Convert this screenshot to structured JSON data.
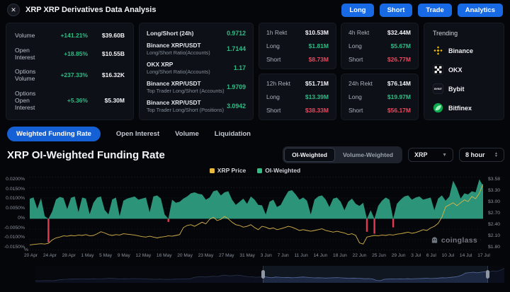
{
  "header": {
    "title": "XRP XRP Derivatives Data Analysis",
    "close_glyph": "✕",
    "buttons": [
      {
        "label": "Long"
      },
      {
        "label": "Short"
      },
      {
        "label": "Trade"
      },
      {
        "label": "Analytics"
      }
    ]
  },
  "stats": {
    "rows": [
      {
        "label": "Volume",
        "change": "+141.21%",
        "value": "$39.60B"
      },
      {
        "label": "Open Interest",
        "change": "+18.85%",
        "value": "$10.55B"
      },
      {
        "label": "Options Volume",
        "change": "+237.33%",
        "value": "$16.32K"
      },
      {
        "label": "Options Open Interest",
        "change": "+5.36%",
        "value": "$5.30M"
      }
    ]
  },
  "ratios": {
    "rows": [
      {
        "title": "Long/Short (24h)",
        "subtitle": "",
        "value": "0.9712"
      },
      {
        "title": "Binance XRP/USDT",
        "subtitle": "Long/Short Ratio(Accounts)",
        "value": "1.7144"
      },
      {
        "title": "OKX XRP",
        "subtitle": "Long/Short Ratio(Accounts)",
        "value": "1.17"
      },
      {
        "title": "Binance XRP/USDT",
        "subtitle": "Top Trader Long/Short (Accounts)",
        "value": "1.9709"
      },
      {
        "title": "Binance XRP/USDT",
        "subtitle": "Top Trader Long/Short (Positions)",
        "value": "3.0942"
      }
    ]
  },
  "rekt": {
    "long_label": "Long",
    "short_label": "Short",
    "cards": [
      {
        "title": "1h Rekt",
        "total": "$10.53M",
        "long": "$1.81M",
        "short": "$8.73M"
      },
      {
        "title": "4h Rekt",
        "total": "$32.44M",
        "long": "$5.67M",
        "short": "$26.77M"
      },
      {
        "title": "12h Rekt",
        "total": "$51.71M",
        "long": "$13.39M",
        "short": "$38.33M"
      },
      {
        "title": "24h Rekt",
        "total": "$76.14M",
        "long": "$19.97M",
        "short": "$56.17M"
      }
    ]
  },
  "trending": {
    "title": "Trending",
    "items": [
      {
        "name": "Binance",
        "icon": "binance-icon",
        "brand_color": "#f0b90b"
      },
      {
        "name": "OKX",
        "icon": "okx-icon",
        "brand_color": "#000000"
      },
      {
        "name": "Bybit",
        "icon": "bybit-icon",
        "icon_text": "BYBIT",
        "brand_color": "#15192a"
      },
      {
        "name": "Bitfinex",
        "icon": "bitfinex-icon",
        "brand_color": "#0fa84e"
      }
    ]
  },
  "tabs": [
    {
      "label": "Weighted Funding Rate",
      "active": true
    },
    {
      "label": "Open Interest",
      "active": false
    },
    {
      "label": "Volume",
      "active": false
    },
    {
      "label": "Liquidation",
      "active": false
    }
  ],
  "section": {
    "title": "XRP OI-Weighted Funding Rate",
    "toggle_options": [
      "OI-Weighted",
      "Volume-Weighted"
    ],
    "toggle_active": 0,
    "symbol_select": "XRP",
    "interval_select": "8 hour"
  },
  "watermark": "coinglass",
  "chart_data": {
    "type": "area+line",
    "title": "XRP OI-Weighted Funding Rate",
    "grid": true,
    "legend": [
      {
        "label": "XRP Price",
        "color": "#e7b93c"
      },
      {
        "label": "OI-Weighted",
        "color": "#2ebd85"
      }
    ],
    "y_left": {
      "unit": "%",
      "min": -0.015,
      "max": 0.02,
      "labels": [
        "0.0200%",
        "0.0150%",
        "0.0100%",
        "0.0050%",
        "0%",
        "-0.0050%",
        "-0.0100%",
        "-0.0150%"
      ]
    },
    "y_right": {
      "unit": "$",
      "min": 1.8,
      "max": 3.58,
      "labels": [
        "$3.58",
        "$3.30",
        "$3.00",
        "$2.70",
        "$2.40",
        "$2.10",
        "$1.80"
      ]
    },
    "x_labels": [
      "20 Apr",
      "24 Apr",
      "28 Apr",
      "1 May",
      "5 May",
      "9 May",
      "12 May",
      "16 May",
      "20 May",
      "23 May",
      "27 May",
      "31 May",
      "3 Jun",
      "7 Jun",
      "11 Jun",
      "14 Jun",
      "18 Jun",
      "22 Jun",
      "25 Jun",
      "29 Jun",
      "3 Jul",
      "6 Jul",
      "10 Jul",
      "14 Jul",
      "17 Jul"
    ],
    "series": [
      {
        "name": "OI-Weighted",
        "type": "area",
        "axis": "left",
        "color": "#2e9c80",
        "negative_color": "#e13a52",
        "values": [
          0.0095,
          0.0102,
          0.0048,
          0.0098,
          0.0012,
          -0.0112,
          0.0035,
          0.0092,
          0.0104,
          0.0099,
          0.0046,
          0.01,
          0.0106,
          0.0032,
          0.0101,
          0.0096,
          0.0022,
          0.0076,
          0.0101,
          0.0106,
          0.0042,
          0.0021,
          0.0092,
          0.0101,
          0.0013,
          0.0086,
          0.0096,
          0.0101,
          0.0106,
          0.0091,
          0.0096,
          0.0101,
          0.0031,
          0.0106,
          0.0111,
          0.0096,
          0.0021,
          -0.0015,
          0.0091,
          0.0076,
          0.0081,
          0.0096,
          0.0106,
          0.0121,
          0.0126,
          0.0119,
          0.0116,
          0.0091,
          0.0101,
          0.0131,
          0.0136,
          0.0111,
          0.0126,
          0.0131,
          0.0091,
          0.0066,
          0.0081,
          0.0096,
          0.0071,
          0.0106,
          0.0091,
          0.0066,
          0.0064,
          0.0021,
          0.0081,
          0.0091,
          0.0056,
          0.0066,
          0.0101,
          0.0131,
          0.0136,
          0.0116,
          0.0091,
          0.0101,
          0.0086,
          0.0021,
          0.0091,
          0.0106,
          0.0111,
          0.0091,
          0.0056,
          0.0096,
          0.0101,
          0.0081,
          0.0041,
          0.0081,
          0.0096,
          0.0071,
          0.0061,
          0.0076,
          -0.0062,
          0.0041,
          -0.0071,
          0.0061,
          0.0086,
          0.0101,
          0.0091,
          -0.0041,
          0.0071,
          0.0091,
          0.0106,
          0.0111,
          0.0091,
          0.0101,
          0.0106,
          0.0091,
          0.0096,
          0.0101,
          0.0041,
          0.0096,
          0.0111,
          0.0086,
          0.0106,
          0.0181,
          0.0146,
          0.0096,
          0.0121,
          0.0116,
          0.0131,
          0.0126,
          0.0188,
          0.0156
        ]
      },
      {
        "name": "XRP Price",
        "type": "line",
        "axis": "right",
        "color": "#d8b44a",
        "values": [
          1.93,
          1.94,
          1.95,
          1.96,
          1.95,
          1.97,
          2.05,
          2.1,
          2.12,
          2.15,
          2.14,
          2.16,
          2.15,
          2.17,
          2.16,
          2.18,
          2.15,
          2.16,
          2.2,
          2.25,
          2.22,
          2.18,
          2.16,
          2.18,
          2.17,
          2.2,
          2.19,
          2.18,
          2.17,
          2.15,
          2.13,
          2.12,
          2.14,
          2.12,
          2.1,
          2.12,
          2.13,
          2.15,
          2.14,
          2.16,
          2.18,
          2.35,
          2.4,
          2.42,
          2.38,
          2.43,
          2.48,
          2.44,
          2.55,
          2.6,
          2.52,
          2.55,
          2.62,
          2.56,
          2.48,
          2.42,
          2.4,
          2.36,
          2.38,
          2.42,
          2.35,
          2.3,
          2.38,
          2.36,
          2.32,
          2.34,
          2.3,
          2.32,
          2.35,
          2.38,
          2.36,
          2.32,
          2.28,
          2.3,
          2.28,
          2.26,
          2.28,
          2.3,
          2.32,
          2.28,
          2.26,
          2.24,
          2.26,
          2.24,
          2.22,
          2.18,
          2.2,
          2.16,
          1.98,
          1.95,
          2.12,
          2.14,
          2.16,
          2.15,
          2.17,
          2.16,
          2.18,
          2.17,
          2.19,
          2.2,
          2.22,
          2.24,
          2.21,
          2.23,
          2.26,
          2.3,
          2.28,
          2.34,
          2.38,
          2.45,
          2.6,
          2.85,
          2.9,
          2.95,
          2.88,
          2.95,
          3.02,
          2.98,
          3.1,
          3.05,
          3.18,
          3.4
        ]
      }
    ],
    "navigator": {
      "selection_start_pct": 48.5,
      "selection_end_pct": 96.5
    }
  }
}
